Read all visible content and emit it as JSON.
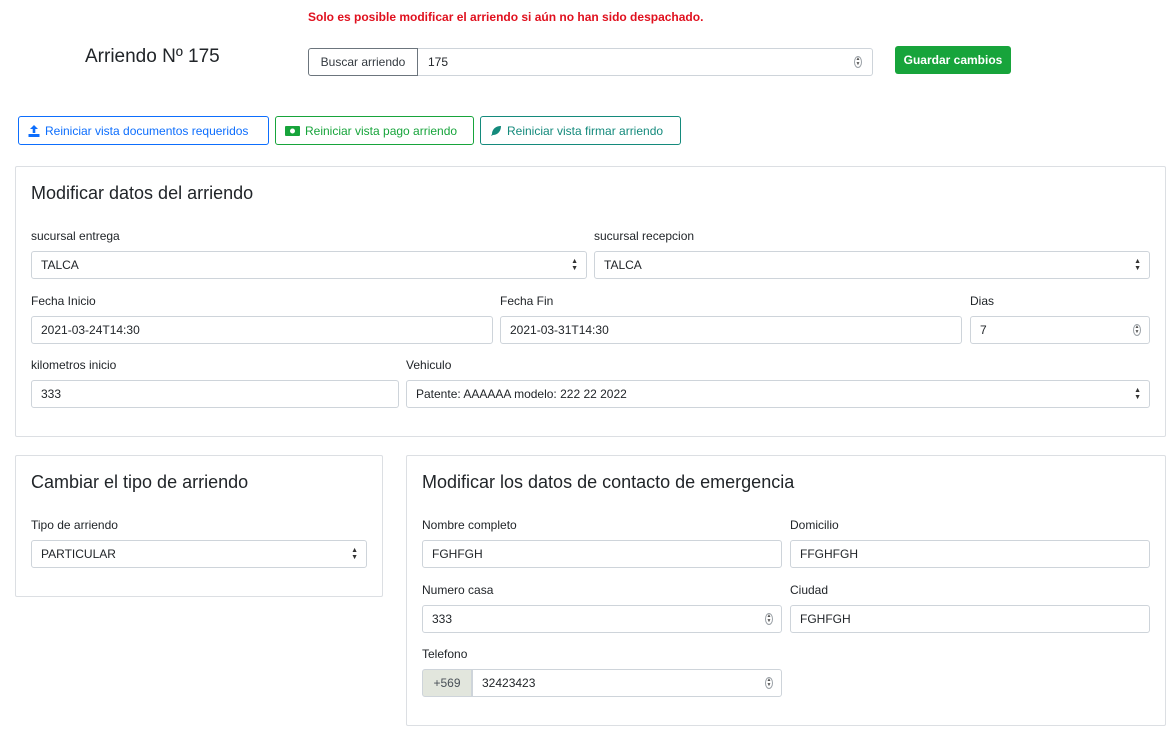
{
  "notice": "Solo es posible modificar el arriendo si aún no han sido despachado.",
  "page_title": "Arriendo Nº 175",
  "search": {
    "button_label": "Buscar arriendo",
    "value": "175"
  },
  "save_label": "Guardar cambios",
  "reset_buttons": {
    "documents": "Reiniciar vista documentos requeridos",
    "payment": "Reiniciar vista pago arriendo",
    "sign": "Reiniciar vista firmar arriendo"
  },
  "rental_data": {
    "title": "Modificar datos del arriendo",
    "branch_delivery": {
      "label": "sucursal entrega",
      "value": "TALCA"
    },
    "branch_reception": {
      "label": "sucursal recepcion",
      "value": "TALCA"
    },
    "start_date": {
      "label": "Fecha Inicio",
      "value": "2021-03-24T14:30"
    },
    "end_date": {
      "label": "Fecha Fin",
      "value": "2021-03-31T14:30"
    },
    "days": {
      "label": "Dias",
      "value": "7"
    },
    "km_start": {
      "label": "kilometros inicio",
      "value": "333"
    },
    "vehicle": {
      "label": "Vehiculo",
      "value": "Patente: AAAAAA modelo: 222 22 2022"
    }
  },
  "rental_type": {
    "title": "Cambiar el tipo de arriendo",
    "type": {
      "label": "Tipo de arriendo",
      "value": "PARTICULAR"
    }
  },
  "emergency_contact": {
    "title": "Modificar los datos de contacto de emergencia",
    "full_name": {
      "label": "Nombre completo",
      "value": "FGHFGH"
    },
    "address": {
      "label": "Domicilio",
      "value": "FFGHFGH"
    },
    "house_number": {
      "label": "Numero casa",
      "value": "333"
    },
    "city": {
      "label": "Ciudad",
      "value": "FGHFGH"
    },
    "phone": {
      "label": "Telefono",
      "prefix": "+569",
      "value": "32423423"
    }
  },
  "colors": {
    "notice": "#e0101e",
    "save": "#17a43b",
    "primary": "#0d6efd",
    "success": "#17a43b",
    "teal": "#148a7c"
  }
}
